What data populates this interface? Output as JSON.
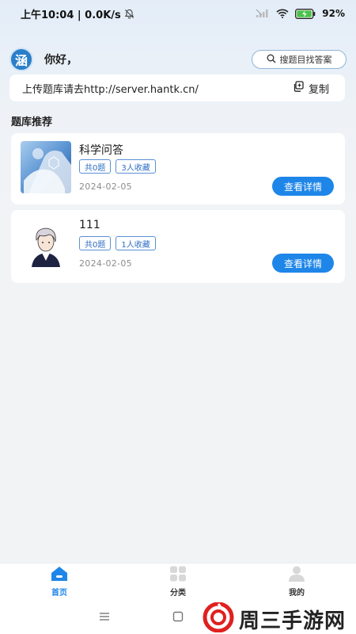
{
  "status_bar": {
    "time_speed": "上午10:04 | 0.0K/s",
    "battery": "92%"
  },
  "header": {
    "logo_char": "涵",
    "greeting": "你好，",
    "search_label": "搜题目找答案"
  },
  "upload": {
    "text": "上传题库请去http://server.hantk.cn/",
    "copy_label": "复制"
  },
  "section_title": "题库推荐",
  "banks": [
    {
      "title": "科学问答",
      "count_tag": "共0题",
      "fav_tag": "3人收藏",
      "date": "2024-02-05",
      "button": "查看详情"
    },
    {
      "title": "111",
      "count_tag": "共0题",
      "fav_tag": "1人收藏",
      "date": "2024-02-05",
      "button": "查看详情"
    }
  ],
  "bottom_nav": [
    {
      "label": "首页",
      "active": true
    },
    {
      "label": "分类",
      "active": false
    },
    {
      "label": "我的",
      "active": false
    }
  ],
  "watermark": "周三手游网",
  "colors": {
    "accent": "#1e86e8",
    "tag_border": "#5b8fd6",
    "background": "#f2f3f5"
  }
}
